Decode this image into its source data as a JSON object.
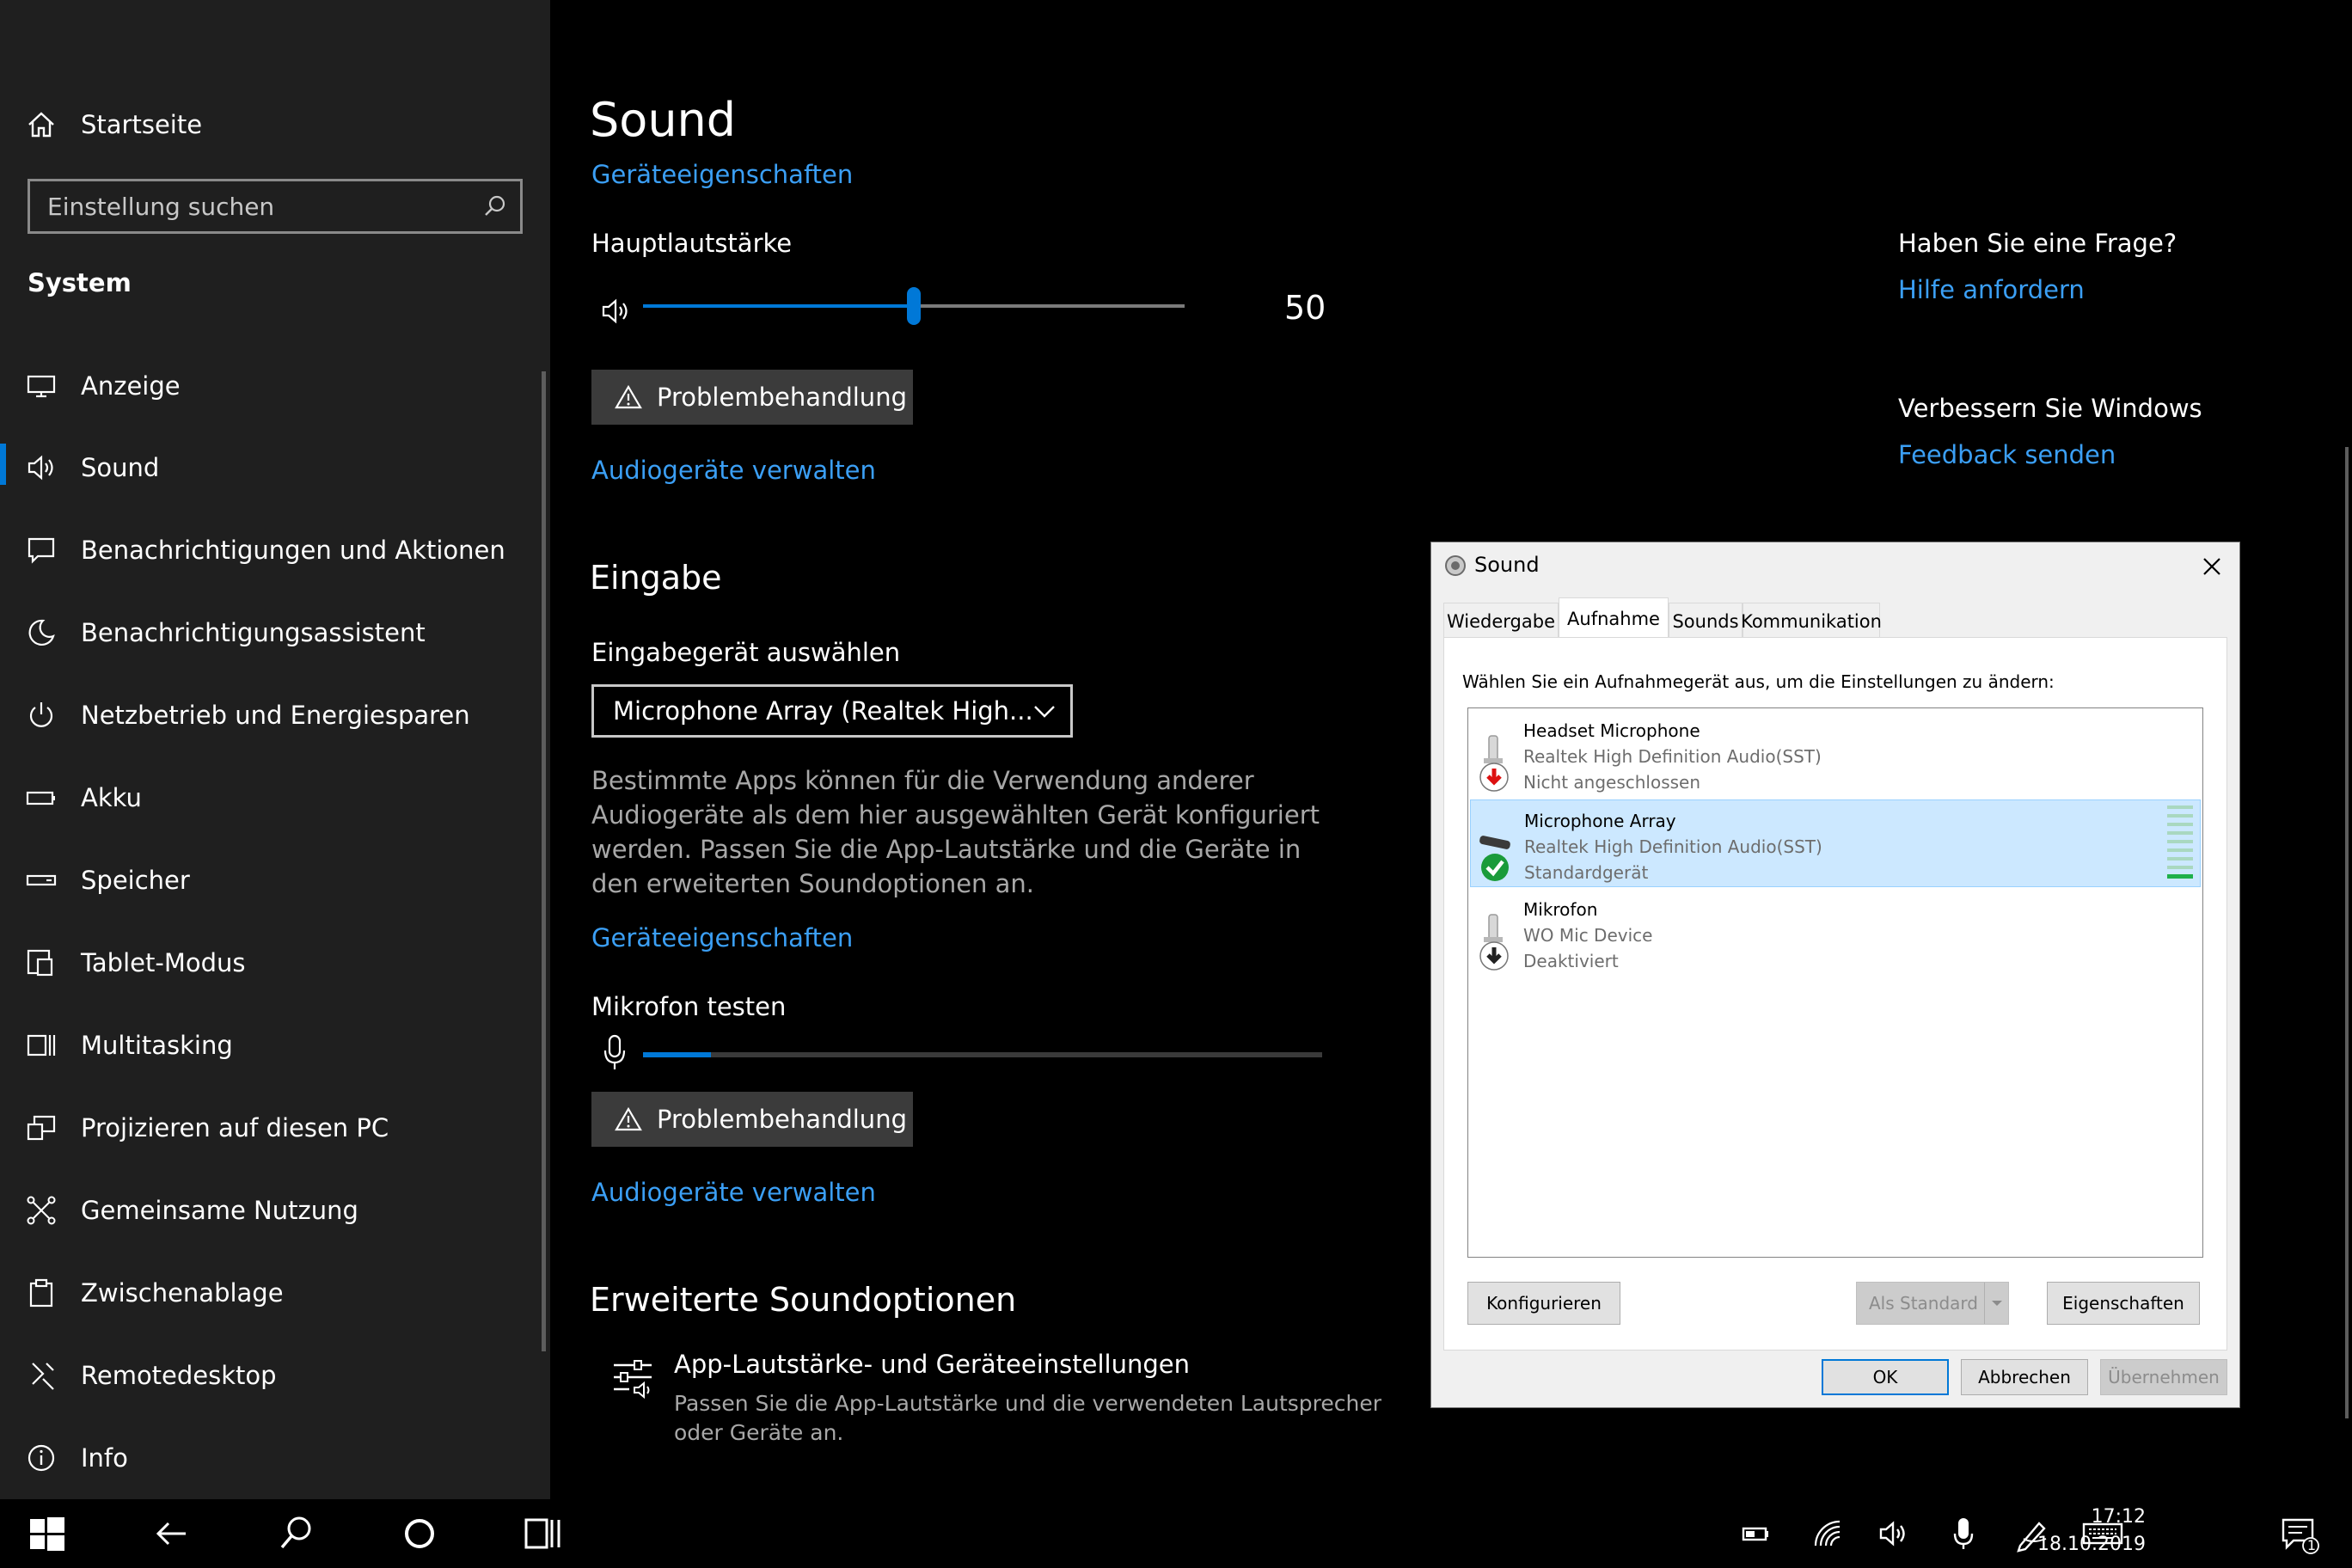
{
  "sidebar": {
    "home": "Startseite",
    "search_placeholder": "Einstellung suchen",
    "section": "System",
    "items": [
      {
        "label": "Anzeige"
      },
      {
        "label": "Sound"
      },
      {
        "label": "Benachrichtigungen und Aktionen"
      },
      {
        "label": "Benachrichtigungsassistent"
      },
      {
        "label": "Netzbetrieb und Energiesparen"
      },
      {
        "label": "Akku"
      },
      {
        "label": "Speicher"
      },
      {
        "label": "Tablet-Modus"
      },
      {
        "label": "Multitasking"
      },
      {
        "label": "Projizieren auf diesen PC"
      },
      {
        "label": "Gemeinsame Nutzung"
      },
      {
        "label": "Zwischenablage"
      },
      {
        "label": "Remotedesktop"
      },
      {
        "label": "Info"
      }
    ],
    "selected": "Sound"
  },
  "main": {
    "title": "Sound",
    "device_properties_link": "Geräteeigenschaften",
    "master_volume_label": "Hauptlautstärke",
    "master_volume_value": "50",
    "master_volume_percent": 50,
    "troubleshoot_label": "Problembehandlung",
    "manage_devices_link": "Audiogeräte verwalten",
    "input": {
      "heading": "Eingabe",
      "select_label": "Eingabegerät auswählen",
      "select_value": "Microphone Array (Realtek High...",
      "description": "Bestimmte Apps können für die Verwendung anderer Audiogeräte als dem hier ausgewählten Gerät konfiguriert werden. Passen Sie die App-Lautstärke und die Geräte in den erweiterten Soundoptionen an.",
      "device_properties_link": "Geräteeigenschaften",
      "test_label": "Mikrofon testen",
      "test_level_percent": 10,
      "troubleshoot_label": "Problembehandlung",
      "manage_devices_link": "Audiogeräte verwalten"
    },
    "advanced": {
      "heading": "Erweiterte Soundoptionen",
      "item_title": "App-Lautstärke- und Geräteeinstellungen",
      "item_desc_line1": "Passen Sie die App-Lautstärke und die verwendeten Lautsprecher",
      "item_desc_line2": "oder Geräte an."
    }
  },
  "right_panel": {
    "question_heading": "Haben Sie eine Frage?",
    "help_link": "Hilfe anfordern",
    "improve_heading": "Verbessern Sie Windows",
    "feedback_link": "Feedback senden"
  },
  "dialog": {
    "title": "Sound",
    "tabs": [
      "Wiedergabe",
      "Aufnahme",
      "Sounds",
      "Kommunikation"
    ],
    "active_tab": "Aufnahme",
    "instruction": "Wählen Sie ein Aufnahmegerät aus, um die Einstellungen zu ändern:",
    "devices": [
      {
        "name": "Headset Microphone",
        "driver": "Realtek High Definition Audio(SST)",
        "status": "Nicht angeschlossen"
      },
      {
        "name": "Microphone Array",
        "driver": "Realtek High Definition Audio(SST)",
        "status": "Standardgerät"
      },
      {
        "name": "Mikrofon",
        "driver": "WO Mic Device",
        "status": "Deaktiviert"
      }
    ],
    "buttons": {
      "configure": "Konfigurieren",
      "set_default": "Als Standard",
      "properties": "Eigenschaften",
      "ok": "OK",
      "cancel": "Abbrechen",
      "apply": "Übernehmen"
    }
  },
  "taskbar": {
    "time": "17:12",
    "date": "18.10.2019",
    "notification_count": "1"
  },
  "colors": {
    "accent": "#0078d7",
    "link": "#3b9ff5",
    "sidebar_bg": "#1f1f1f",
    "main_bg": "#000000"
  }
}
